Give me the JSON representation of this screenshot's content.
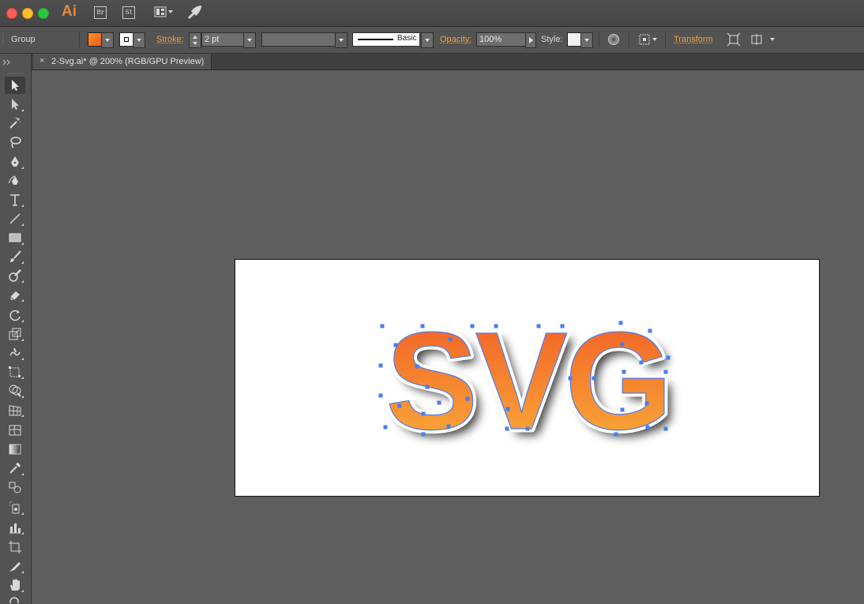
{
  "app": {
    "logo": "Ai",
    "bridge_label": "Br",
    "stock_label": "St"
  },
  "control_bar": {
    "selection_type": "Group",
    "stroke_label": "Stroke:",
    "stroke_weight": "2 pt",
    "brush_label": "Basic",
    "opacity_label": "Opacity:",
    "opacity_value": "100%",
    "style_label": "Style:",
    "transform_label": "Transform"
  },
  "document": {
    "tab_close": "×",
    "tab_title": "2-Svg.ai* @ 200% (RGB/GPU Preview)"
  },
  "artwork": {
    "text": "SVG",
    "gradient_top": "#f15a24",
    "gradient_bottom": "#fbb03b",
    "selection_color": "#4a7cf0"
  },
  "colors": {
    "fill_swatch_start": "#f7931e",
    "fill_swatch_end": "#f15a24",
    "accent_link": "#f0a040"
  },
  "tools": [
    "selection-tool",
    "direct-selection-tool",
    "magic-wand-tool",
    "lasso-tool",
    "pen-tool",
    "curvature-tool",
    "type-tool",
    "line-tool",
    "rectangle-tool",
    "paintbrush-tool",
    "shaper-tool",
    "eraser-tool",
    "rotate-tool",
    "scale-tool",
    "warp-tool",
    "free-transform-tool",
    "shape-builder-tool",
    "perspective-grid-tool",
    "mesh-tool",
    "gradient-tool",
    "eyedropper-tool",
    "blend-tool",
    "symbol-sprayer-tool",
    "column-graph-tool",
    "artboard-tool",
    "slice-tool",
    "hand-tool",
    "zoom-tool"
  ]
}
